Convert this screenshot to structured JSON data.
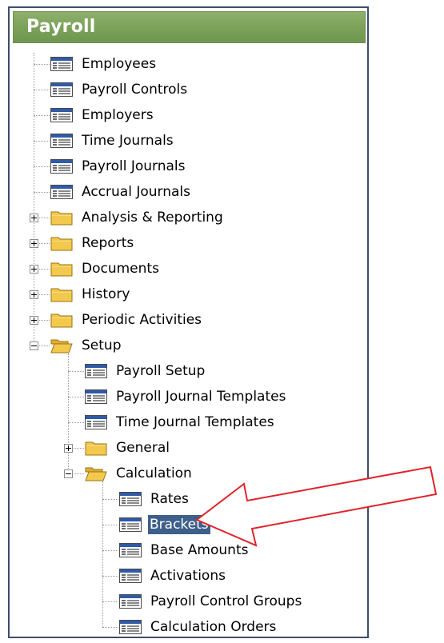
{
  "panel": {
    "title": "Payroll"
  },
  "tree": {
    "items": [
      {
        "label": "Employees",
        "icon": "form-icon"
      },
      {
        "label": "Payroll Controls",
        "icon": "form-icon"
      },
      {
        "label": "Employers",
        "icon": "form-icon"
      },
      {
        "label": "Time Journals",
        "icon": "form-icon"
      },
      {
        "label": "Payroll Journals",
        "icon": "form-icon"
      },
      {
        "label": "Accrual Journals",
        "icon": "form-icon"
      },
      {
        "label": "Analysis & Reporting",
        "icon": "folder-icon",
        "state": "collapsed"
      },
      {
        "label": "Reports",
        "icon": "folder-icon",
        "state": "collapsed"
      },
      {
        "label": "Documents",
        "icon": "folder-icon",
        "state": "collapsed"
      },
      {
        "label": "History",
        "icon": "folder-icon",
        "state": "collapsed"
      },
      {
        "label": "Periodic Activities",
        "icon": "folder-icon",
        "state": "collapsed"
      },
      {
        "label": "Setup",
        "icon": "open-folder-icon",
        "state": "expanded"
      },
      {
        "label": "Payroll Setup",
        "icon": "form-icon"
      },
      {
        "label": "Payroll Journal Templates",
        "icon": "form-icon"
      },
      {
        "label": "Time Journal Templates",
        "icon": "form-icon"
      },
      {
        "label": "General",
        "icon": "folder-icon",
        "state": "collapsed"
      },
      {
        "label": "Calculation",
        "icon": "open-folder-icon",
        "state": "expanded"
      },
      {
        "label": "Rates",
        "icon": "form-icon"
      },
      {
        "label": "Brackets",
        "icon": "form-icon",
        "selected": true
      },
      {
        "label": "Base Amounts",
        "icon": "form-icon"
      },
      {
        "label": "Activations",
        "icon": "form-icon"
      },
      {
        "label": "Payroll Control Groups",
        "icon": "form-icon"
      },
      {
        "label": "Calculation Orders",
        "icon": "form-icon"
      }
    ]
  },
  "annotation": {
    "arrow_color": "#e0242a",
    "points_to": "Brackets"
  },
  "colors": {
    "header": "#7ca25a",
    "selection": "#3d5f8a",
    "folder": "#f2c94c"
  }
}
